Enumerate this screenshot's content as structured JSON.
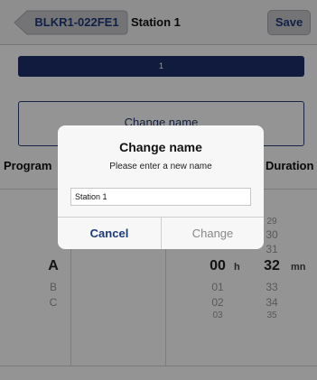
{
  "nav": {
    "back_label": "BLKR1-022FE1",
    "title": "Station 1",
    "save_label": "Save"
  },
  "station_bar": {
    "label": "1"
  },
  "change_name_button": {
    "label": "Change name"
  },
  "columns": {
    "program_header": "Program",
    "duration_header": "Duration"
  },
  "program_picker": {
    "selected": "A",
    "below": [
      "B",
      "C"
    ]
  },
  "hours_picker": {
    "selected": "00",
    "unit": "h",
    "below": [
      "01",
      "02",
      "03"
    ]
  },
  "minutes_picker": {
    "above": [
      "29",
      "30",
      "31"
    ],
    "selected": "32",
    "unit": "mn",
    "below": [
      "33",
      "34",
      "35"
    ]
  },
  "dialog": {
    "title": "Change name",
    "message": "Please enter a new name",
    "input_value": "Station 1",
    "cancel_label": "Cancel",
    "change_label": "Change"
  },
  "colors": {
    "accent": "#1c2f6b",
    "link": "#1d3a7a",
    "overlay": "rgba(0,0,0,0.42)"
  }
}
